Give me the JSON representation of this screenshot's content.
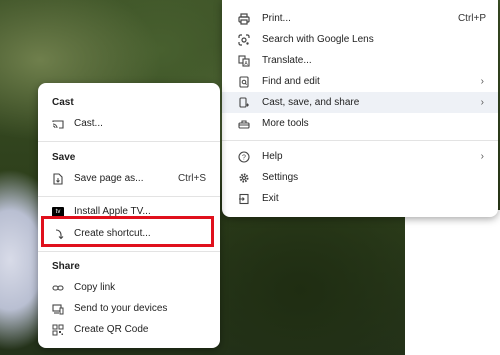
{
  "main_menu": {
    "items": [
      {
        "label": "Print...",
        "shortcut": "Ctrl+P",
        "icon": "print-icon"
      },
      {
        "label": "Search with Google Lens",
        "icon": "google-lens-icon"
      },
      {
        "label": "Translate...",
        "icon": "translate-icon"
      },
      {
        "label": "Find and edit",
        "icon": "find-icon"
      },
      {
        "label": "Cast, save, and share",
        "icon": "cast-save-share-icon"
      },
      {
        "label": "More tools",
        "icon": "toolbox-icon"
      },
      {
        "label": "Help",
        "icon": "help-icon"
      },
      {
        "label": "Settings",
        "icon": "gear-icon"
      },
      {
        "label": "Exit",
        "icon": "exit-icon"
      }
    ]
  },
  "sub_menu": {
    "sections": {
      "cast": "Cast",
      "save": "Save",
      "share": "Share"
    },
    "items": {
      "cast": {
        "label": "Cast...",
        "icon": "cast-icon"
      },
      "save_page": {
        "label": "Save page as...",
        "shortcut": "Ctrl+S",
        "icon": "save-page-icon"
      },
      "install_app": {
        "label": "Install Apple TV...",
        "icon": "apple-tv-icon",
        "icon_text": "tv"
      },
      "create_shortcut": {
        "label": "Create shortcut...",
        "icon": "shortcut-icon"
      },
      "copy_link": {
        "label": "Copy link",
        "icon": "link-icon"
      },
      "send_devices": {
        "label": "Send to your devices",
        "icon": "devices-icon"
      },
      "qr_code": {
        "label": "Create QR Code",
        "icon": "qr-code-icon"
      }
    }
  },
  "colors": {
    "highlight": "#eef1f6",
    "annotation_box": "#e0101c"
  }
}
